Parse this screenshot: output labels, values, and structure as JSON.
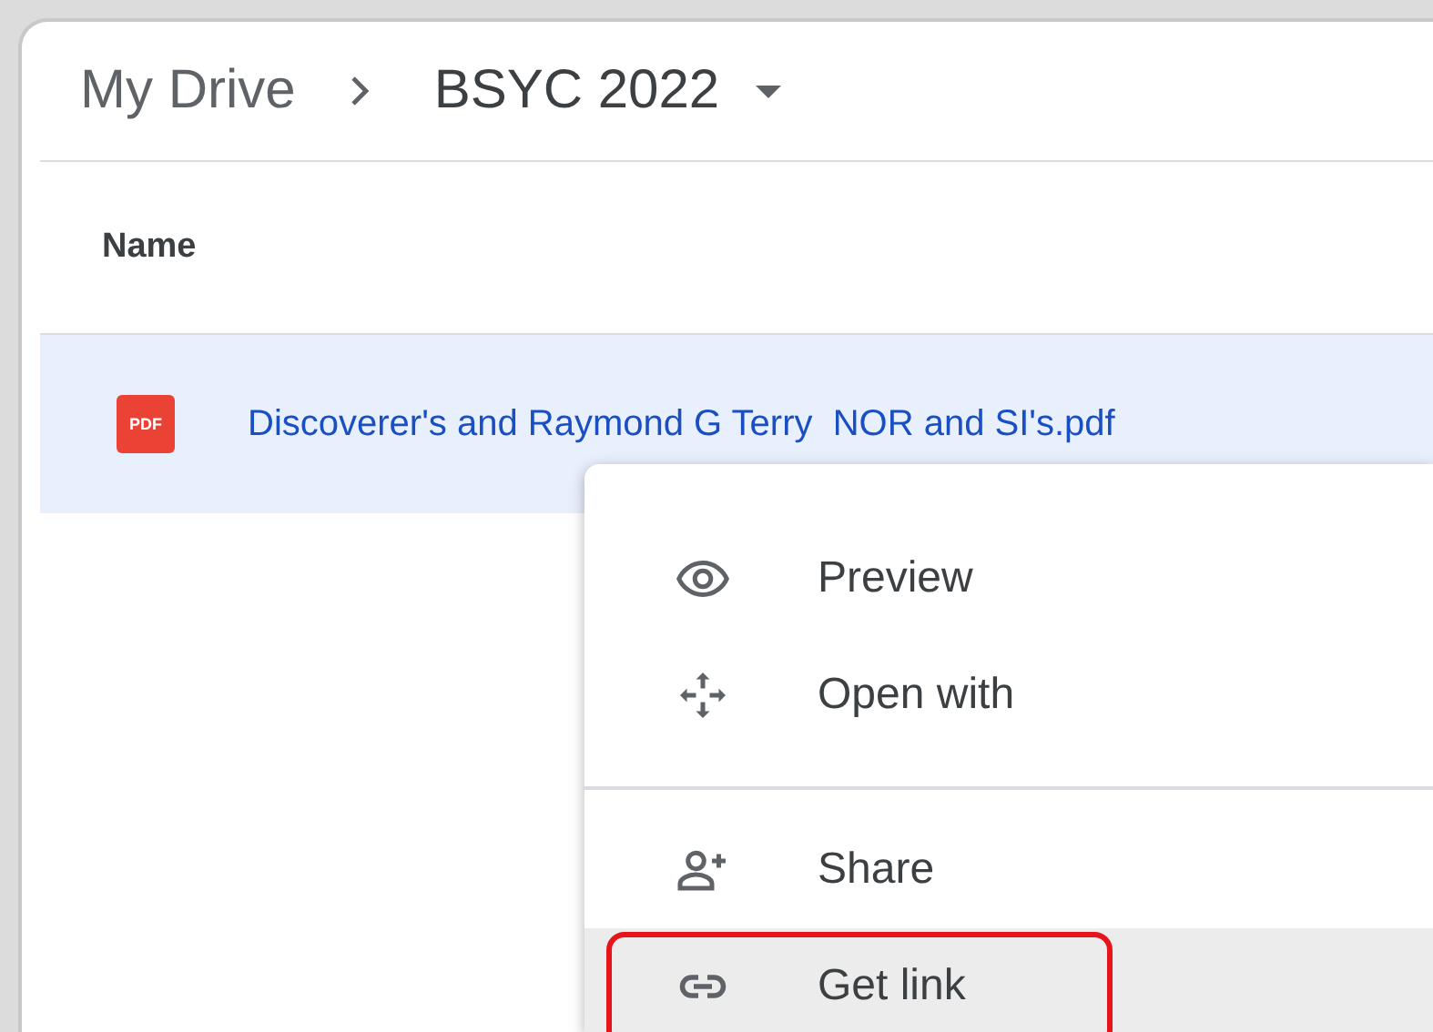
{
  "breadcrumb": [
    {
      "label": "My Drive",
      "current": false
    },
    {
      "label": "BSYC 2022",
      "current": true
    }
  ],
  "table": {
    "columns": [
      "Name"
    ],
    "rows": [
      {
        "name": "Discoverer's and Raymond G Terry  NOR and SI's.pdf",
        "file_type": "PDF",
        "selected": true
      }
    ]
  },
  "context_menu": {
    "items": [
      {
        "label": "Preview",
        "selected": false,
        "annotated": false,
        "divider_before": false
      },
      {
        "label": "Open with",
        "selected": false,
        "annotated": false,
        "divider_before": false
      },
      {
        "label": "Share",
        "selected": false,
        "annotated": false,
        "divider_before": true
      },
      {
        "label": "Get link",
        "selected": true,
        "annotated": true,
        "divider_before": false
      }
    ]
  }
}
